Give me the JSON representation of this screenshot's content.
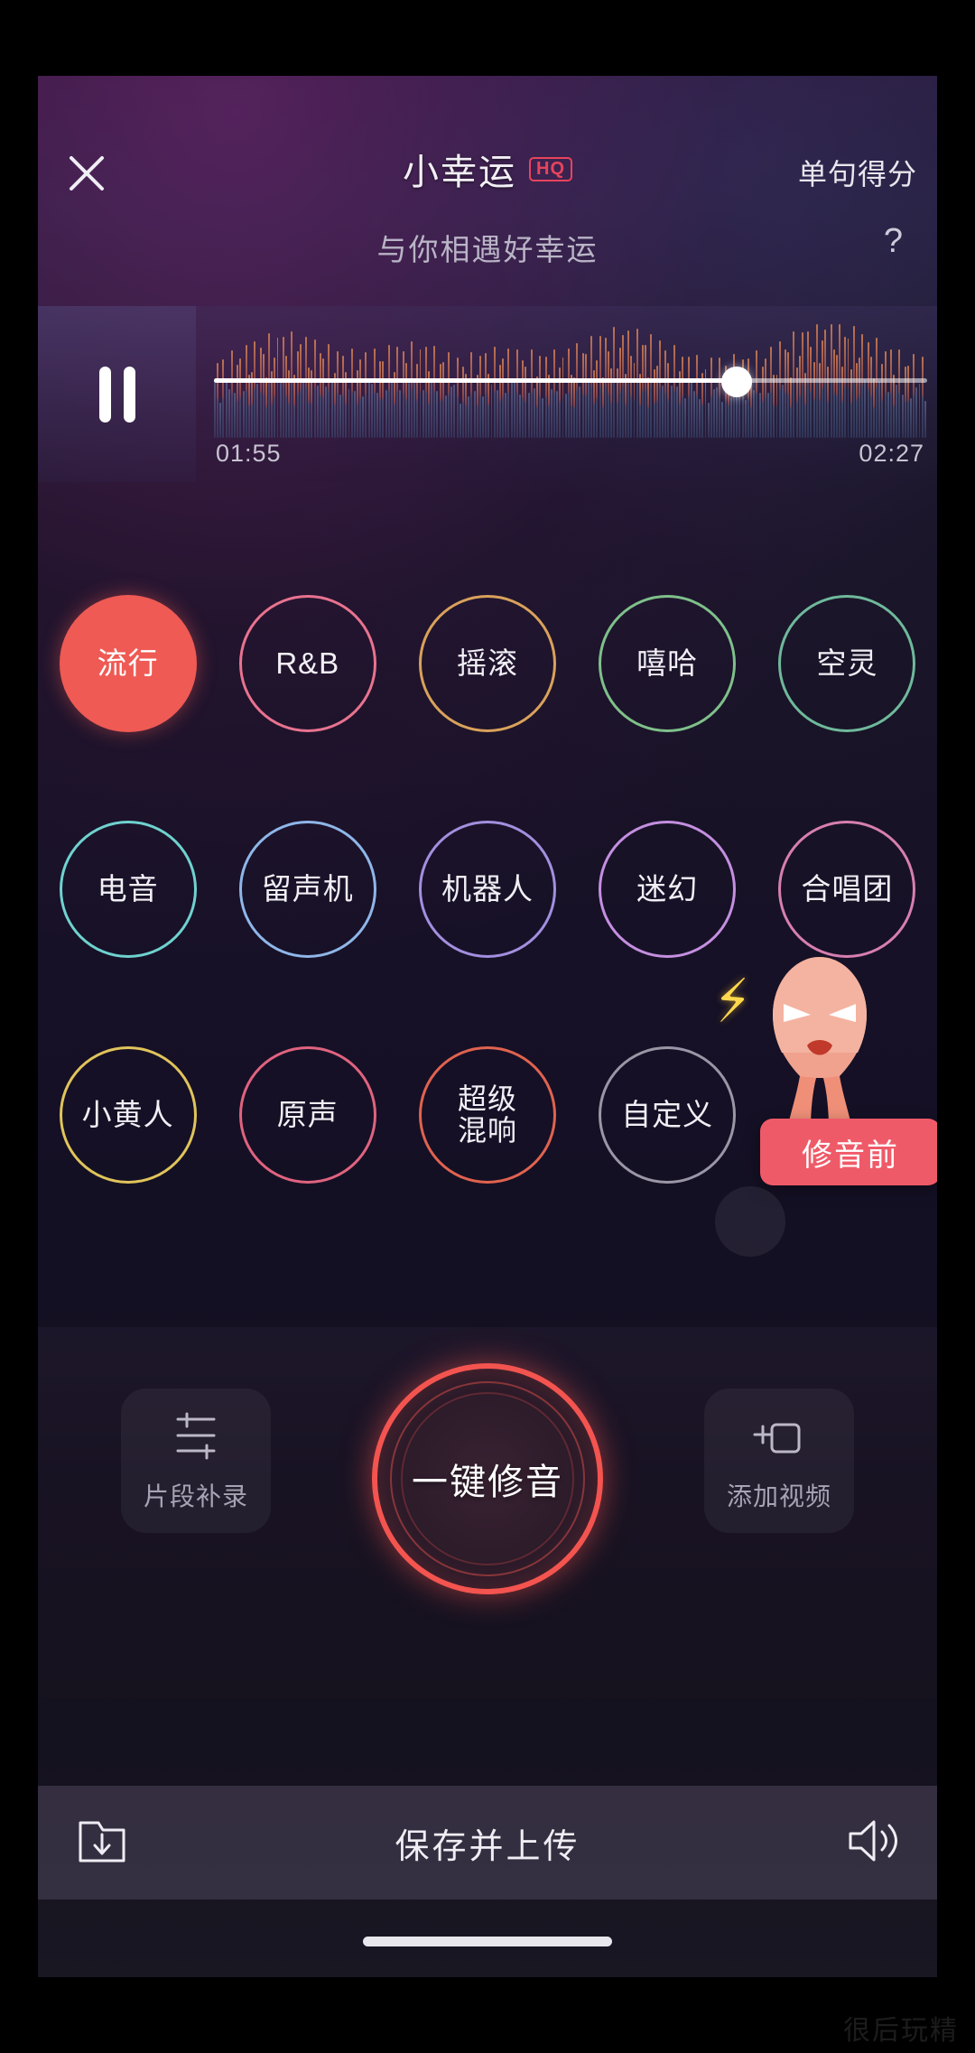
{
  "header": {
    "close_icon": "close-icon",
    "song_title": "小幸运",
    "quality_badge": "HQ",
    "score_link": "单句得分"
  },
  "lyric": {
    "current_line": "与你相遇好幸运",
    "help_icon": "?"
  },
  "player": {
    "state_icon": "pause-icon",
    "current_time": "01:55",
    "total_time": "02:27",
    "progress_percent": 73
  },
  "effects": {
    "rows": [
      [
        {
          "label": "流行",
          "color": "#ef5a54",
          "active": true
        },
        {
          "label": "R&B",
          "color": "#e8738f",
          "active": false
        },
        {
          "label": "摇滚",
          "color": "#d9a25b",
          "active": false
        },
        {
          "label": "嘻哈",
          "color": "#7fc08a",
          "active": false
        },
        {
          "label": "空灵",
          "color": "#6fb99b",
          "active": false
        }
      ],
      [
        {
          "label": "电音",
          "color": "#6fd2cf",
          "active": false
        },
        {
          "label": "留声机",
          "color": "#8fb6e8",
          "active": false
        },
        {
          "label": "机器人",
          "color": "#a38fe0",
          "active": false
        },
        {
          "label": "迷幻",
          "color": "#c48fe0",
          "active": false
        },
        {
          "label": "合唱团",
          "color": "#d77fb0",
          "active": false
        }
      ],
      [
        {
          "label": "小黄人",
          "color": "#e0c45b",
          "active": false
        },
        {
          "label": "原声",
          "color": "#e0637f",
          "active": false
        },
        {
          "label": "超级\n混响",
          "color": "#e0634f",
          "active": false
        },
        {
          "label": "自定义",
          "color": "#9a96a6",
          "active": false
        }
      ]
    ]
  },
  "mascot": {
    "icon": "angry-mascot-icon",
    "bolt_icon": "lightning-bolt-icon",
    "tooltip_label": "修音前"
  },
  "actions": {
    "left_button": {
      "label": "片段补录",
      "icon": "segment-rerecord-icon"
    },
    "main_button": {
      "label": "一键修音"
    },
    "right_button": {
      "label": "添加视频",
      "icon": "add-video-icon"
    }
  },
  "save_bar": {
    "download_icon": "download-folder-icon",
    "label": "保存并上传",
    "volume_icon": "speaker-icon"
  },
  "watermark": "很后玩精",
  "colors": {
    "accent": "#ef5a54",
    "badge": "#e8445c",
    "tooltip": "#ef5a68"
  }
}
